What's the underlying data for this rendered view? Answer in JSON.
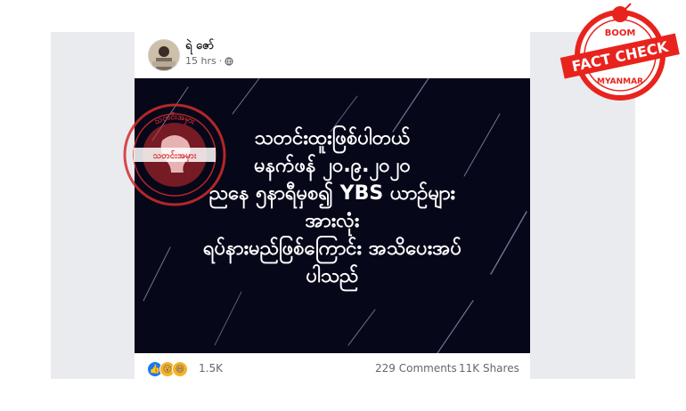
{
  "post": {
    "author": "ရဲ ဇော်",
    "time": "15 hrs",
    "privacy_icon": "globe-icon",
    "image_text": "သတင်းထူးဖြစ်ပါတယ်\nမနက်ဖန် ၂၀.၉.၂၀၂၀\nညနေ ၅နာရီမှစ၍ YBS ယာဉ်များ\nအားလုံး\nရပ်နားမည်ဖြစ်ကြောင်း အသိပေးအပ်\nပါသည်",
    "seal_text_top": "သတင်းအမှား",
    "seal_text_center": "သတင်းအမှား",
    "reactions": [
      "like-icon",
      "wow-icon",
      "haha-icon"
    ],
    "reaction_count": "1.5K",
    "comments": "229 Comments",
    "shares": "11K Shares"
  },
  "badge": {
    "top": "BOOM",
    "middle": "FACT CHECK",
    "bottom": "MYANMAR",
    "color": "#e8231d"
  }
}
